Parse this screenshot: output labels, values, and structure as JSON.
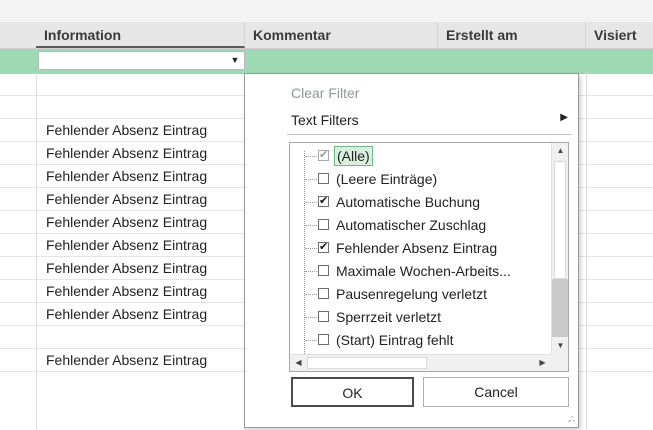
{
  "grid": {
    "columns": [
      "Information",
      "Kommentar",
      "Erstellt am",
      "Visiert"
    ],
    "filter_dropdown_glyph": "▼",
    "rows": [
      "",
      "",
      "Fehlender Absenz Eintrag",
      "Fehlender Absenz Eintrag",
      "Fehlender Absenz Eintrag",
      "Fehlender Absenz Eintrag",
      "Fehlender Absenz Eintrag",
      "Fehlender Absenz Eintrag",
      "Fehlender Absenz Eintrag",
      "Fehlender Absenz Eintrag",
      "Fehlender Absenz Eintrag",
      "",
      "Fehlender Absenz Eintrag"
    ]
  },
  "popup": {
    "clear_filter": "Clear Filter",
    "text_filters": "Text Filters",
    "items": [
      {
        "label": "(Alle)",
        "checked": true,
        "selected": true
      },
      {
        "label": "(Leere Einträge)",
        "checked": false
      },
      {
        "label": "Automatische Buchung",
        "checked": true
      },
      {
        "label": "Automatischer Zuschlag",
        "checked": false
      },
      {
        "label": "Fehlender Absenz Eintrag",
        "checked": true
      },
      {
        "label": "Maximale Wochen-Arbeits...",
        "checked": false
      },
      {
        "label": "Pausenregelung verletzt",
        "checked": false
      },
      {
        "label": "Sperrzeit verletzt",
        "checked": false
      },
      {
        "label": "(Start) Eintrag fehlt",
        "checked": false
      }
    ],
    "ok_label": "OK",
    "cancel_label": "Cancel"
  },
  "colors": {
    "filter_row": "#9dd9b2",
    "header": "#e6e6e6",
    "selection_fill": "#d8f0dd"
  }
}
